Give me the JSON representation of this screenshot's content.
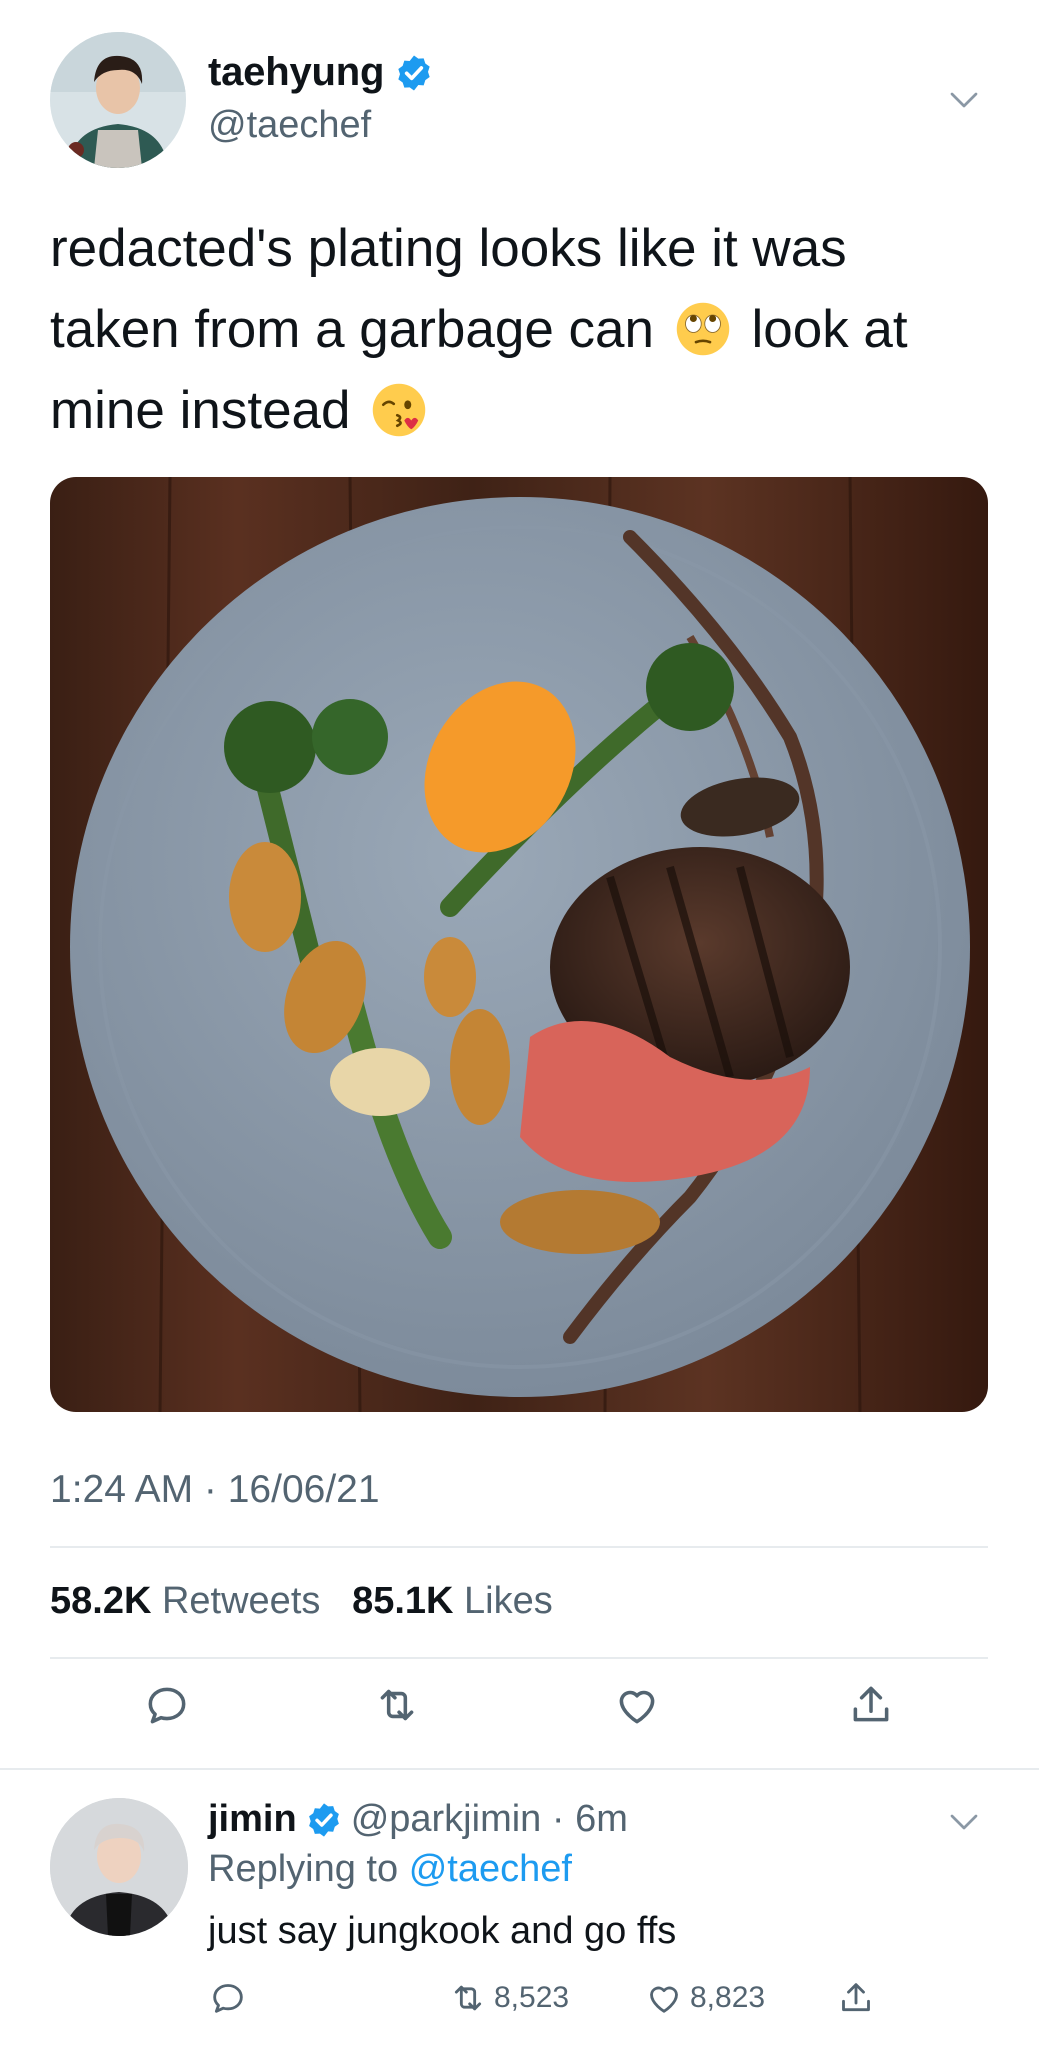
{
  "tweet": {
    "display_name": "taehyung",
    "handle": "@taechef",
    "avatar_icon": "user-avatar",
    "verified_icon": "verified-badge-icon",
    "text_line1": "redacted's plating looks like it was",
    "text_line2a": "taken from a garbage can",
    "text_line2b": "look at",
    "text_line3": "mine instead",
    "emoji_1": "face-with-rolling-eyes",
    "emoji_2": "face-blowing-a-kiss",
    "media_alt": "steak plate photo",
    "timestamp": "1:24 AM · 16/06/21",
    "retweet_count": "58.2K",
    "retweet_label": "Retweets",
    "like_count": "85.1K",
    "like_label": "Likes"
  },
  "actions": [
    "reply-icon",
    "retweet-icon",
    "like-icon",
    "share-icon"
  ],
  "reply": {
    "display_name": "jimin",
    "handle_time": "@parkjimin · 6m",
    "replying_prefix": "Replying to",
    "replying_to": "@taechef",
    "text": "just say jungkook and go ffs",
    "retweet_count": "8,523",
    "like_count": "8,823"
  },
  "colors": {
    "accent": "#1d9bf0",
    "secondary_text": "#536471",
    "primary_text": "#0f1419",
    "divider": "#e7ebee"
  }
}
